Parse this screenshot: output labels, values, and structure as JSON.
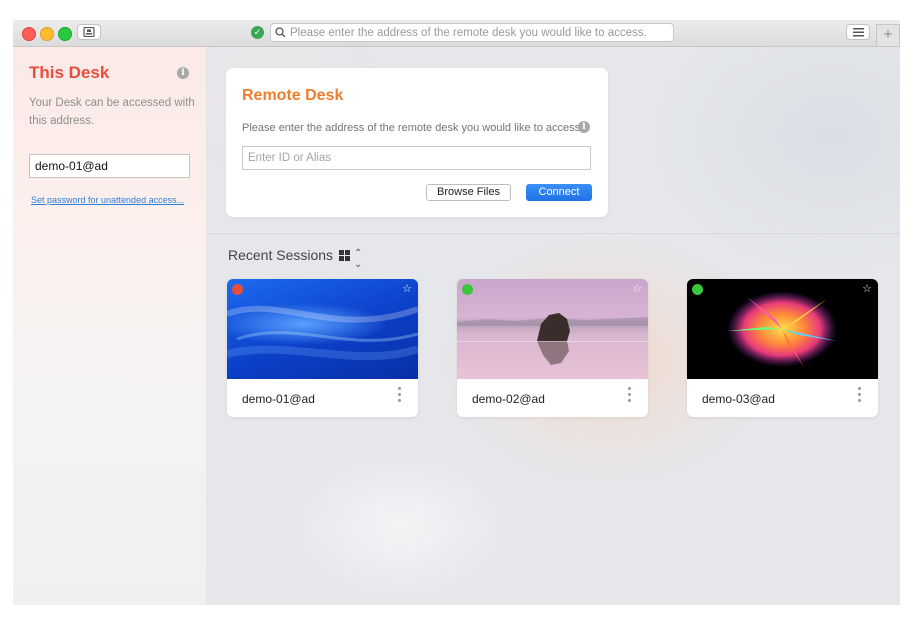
{
  "window": {
    "address_placeholder": "Please enter the address of the remote desk you would like to access.",
    "new_tab_label": "+"
  },
  "sidebar": {
    "title": "This Desk",
    "description": "Your Desk can be accessed with this address.",
    "address_value": "demo-01@ad",
    "set_password_link": "Set password for unattended access..."
  },
  "remote_desk": {
    "title": "Remote Desk",
    "description": "Please enter the address of the remote desk you would like to access.",
    "input_placeholder": "Enter ID or Alias",
    "browse_label": "Browse Files",
    "connect_label": "Connect"
  },
  "recent": {
    "title": "Recent Sessions",
    "sessions": [
      {
        "label": "demo-01@ad",
        "status": "offline",
        "status_color": "#e84e3c",
        "thumbnail": "blue-waves-wallpaper"
      },
      {
        "label": "demo-02@ad",
        "status": "online",
        "status_color": "#3ec53e",
        "thumbnail": "rock-lake-pink-sky-wallpaper"
      },
      {
        "label": "demo-03@ad",
        "status": "online",
        "status_color": "#3ec53e",
        "thumbnail": "color-burst-wallpaper"
      }
    ]
  },
  "colors": {
    "this_desk_title": "#e84e3c",
    "remote_desk_title": "#f07d2c",
    "connect_button": "#2679ee",
    "link": "#2d7fd8"
  }
}
